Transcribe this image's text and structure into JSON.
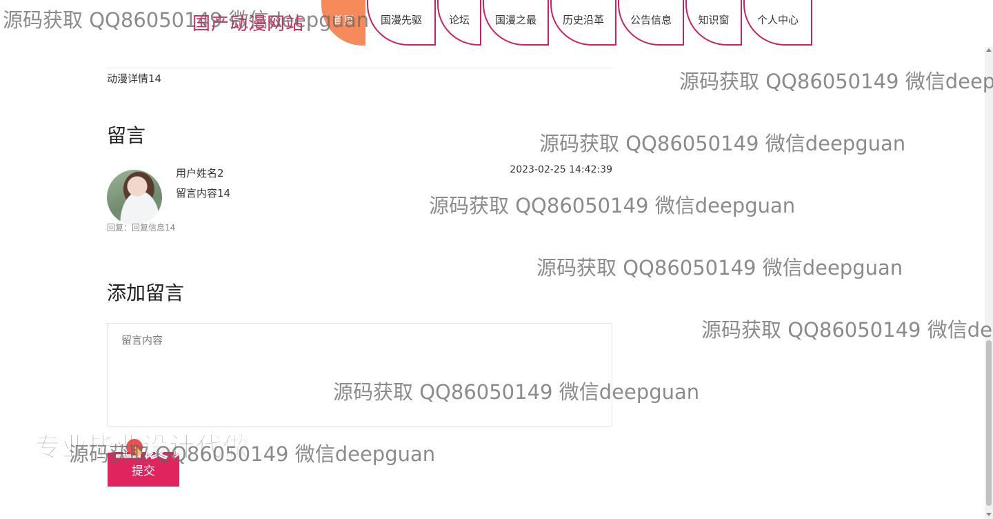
{
  "nav": {
    "site_title": "国产动漫网站",
    "items": [
      {
        "label": "首页"
      },
      {
        "label": "国漫先驱"
      },
      {
        "label": "论坛"
      },
      {
        "label": "国漫之最"
      },
      {
        "label": "历史沿革"
      },
      {
        "label": "公告信息"
      },
      {
        "label": "知识窗"
      },
      {
        "label": "个人中心"
      }
    ]
  },
  "detail": {
    "text": "动漫详情14"
  },
  "comments_section": {
    "title": "留言",
    "items": [
      {
        "user": "用户姓名2",
        "time": "2023-02-25 14:42:39",
        "content": "留言内容14",
        "reply": "回复：回复信息14"
      }
    ]
  },
  "add_comment": {
    "title": "添加留言",
    "placeholder": "留言内容",
    "submit_label": "提交"
  },
  "overlay": {
    "watermark": "源码获取 QQ86050149 微信deepguan",
    "promo": "专业毕业设计代做"
  },
  "colors": {
    "accent": "#e0245e",
    "active_tab": "#f78a5a"
  }
}
